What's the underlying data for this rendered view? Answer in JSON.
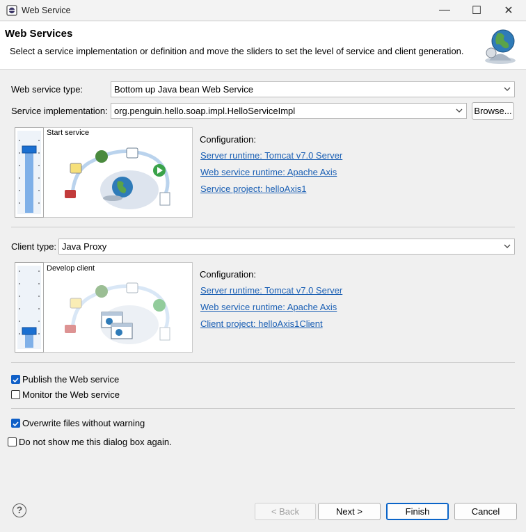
{
  "window": {
    "title": "Web Service",
    "minimize_glyph": "—",
    "maximize_glyph": "☐",
    "close_glyph": "✕"
  },
  "banner": {
    "title": "Web Services",
    "description": "Select a service implementation or definition and move the sliders to set the level of service and client generation.",
    "icon": "globe-wizard-icon"
  },
  "service": {
    "type_label": "Web service type:",
    "type_value": "Bottom up Java bean Web Service",
    "impl_label": "Service implementation:",
    "impl_value": "org.penguin.hello.soap.impl.HelloServiceImpl",
    "browse_label": "Browse...",
    "slider_stage": "Start service",
    "config_label": "Configuration:",
    "links": {
      "server_runtime": "Server runtime: Tomcat v7.0 Server",
      "ws_runtime": "Web service runtime: Apache Axis",
      "project": "Service project: helloAxis1"
    }
  },
  "client": {
    "type_label": "Client type:",
    "type_value": "Java Proxy",
    "slider_stage": "Develop client",
    "config_label": "Configuration:",
    "links": {
      "server_runtime": "Server runtime: Tomcat v7.0 Server",
      "ws_runtime": "Web service runtime: Apache Axis",
      "project": "Client project: helloAxis1Client"
    }
  },
  "options": {
    "publish": {
      "label": "Publish the Web service",
      "checked": true
    },
    "monitor": {
      "label": "Monitor the Web service",
      "checked": false
    },
    "overwrite": {
      "label": "Overwrite files without warning",
      "checked": true
    },
    "dont_show": {
      "label": "Do not show me this dialog box again.",
      "checked": false
    }
  },
  "footer": {
    "help_glyph": "?",
    "back": "< Back",
    "next": "Next >",
    "finish": "Finish",
    "cancel": "Cancel"
  },
  "colors": {
    "accent": "#0f5fc7",
    "link": "#1a5fb4",
    "slider_track": "#7fb0e8"
  }
}
